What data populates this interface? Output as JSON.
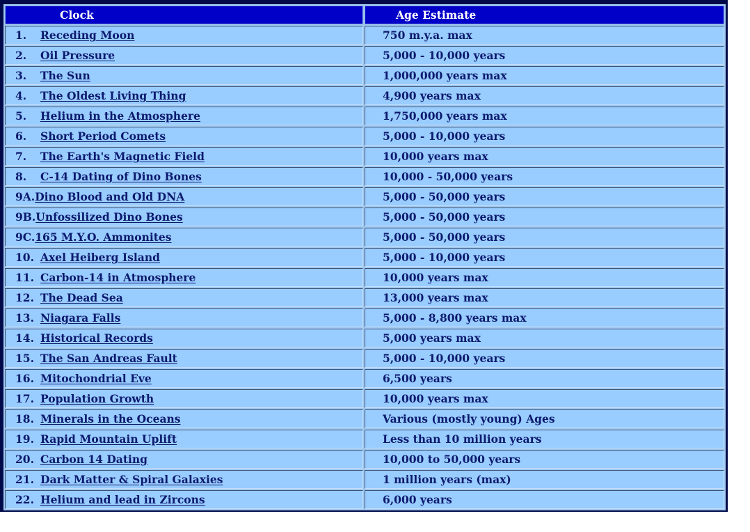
{
  "table": {
    "headers": {
      "clock": "Clock",
      "age": "Age Estimate"
    },
    "colors": {
      "header_bg": "#0000c8",
      "row_bg": "#99ccff",
      "text": "#0c1a6e",
      "frame": "#000a4a"
    },
    "rows": [
      {
        "num": "1.",
        "clock": "Receding Moon",
        "age": "750 m.y.a. max"
      },
      {
        "num": "2.",
        "clock": "Oil Pressure",
        "age": "5,000 - 10,000 years"
      },
      {
        "num": "3.",
        "clock": "The Sun",
        "age": "1,000,000 years max"
      },
      {
        "num": "4.",
        "clock": "The Oldest Living Thing",
        "age": "4,900 years max"
      },
      {
        "num": "5.",
        "clock": "Helium in the Atmosphere",
        "age": "1,750,000 years max"
      },
      {
        "num": "6.",
        "clock": "Short Period Comets",
        "age": "5,000 - 10,000 years"
      },
      {
        "num": "7.",
        "clock": "The Earth's Magnetic Field",
        "age": "10,000 years max"
      },
      {
        "num": "8.",
        "clock": "C-14 Dating of Dino Bones",
        "age": "10,000 - 50,000 years"
      },
      {
        "num": "9A.",
        "clock": "Dino Blood and Old DNA",
        "age": "5,000 - 50,000 years"
      },
      {
        "num": "9B.",
        "clock": "Unfossilized Dino Bones",
        "age": "5,000 - 50,000 years"
      },
      {
        "num": "9C.",
        "clock": "165 M.Y.O. Ammonites",
        "age": "5,000 - 50,000 years"
      },
      {
        "num": "10.",
        "clock": "Axel Heiberg Island",
        "age": "5,000 - 10,000 years"
      },
      {
        "num": "11.",
        "clock": "Carbon-14 in Atmosphere",
        "age": "10,000 years max"
      },
      {
        "num": "12.",
        "clock": "The Dead Sea",
        "age": "13,000 years max"
      },
      {
        "num": "13.",
        "clock": "Niagara Falls",
        "age": "5,000 - 8,800 years max"
      },
      {
        "num": "14.",
        "clock": "Historical Records",
        "age": "5,000 years max"
      },
      {
        "num": "15.",
        "clock": "The San Andreas Fault",
        "age": "5,000 - 10,000 years"
      },
      {
        "num": "16.",
        "clock": "Mitochondrial Eve",
        "age": "6,500 years"
      },
      {
        "num": "17.",
        "clock": "Population Growth",
        "age": "10,000 years max"
      },
      {
        "num": "18.",
        "clock": "Minerals in the Oceans",
        "age": "Various (mostly young) Ages"
      },
      {
        "num": "19.",
        "clock": "Rapid Mountain Uplift",
        "age": "Less than 10 million years"
      },
      {
        "num": "20.",
        "clock": "Carbon 14 Dating",
        "age": "10,000 to 50,000 years"
      },
      {
        "num": "21.",
        "clock": "Dark Matter & Spiral Galaxies",
        "age": "1 million years (max)"
      },
      {
        "num": "22.",
        "clock": "Helium and lead in Zircons",
        "age": "6,000 years"
      }
    ]
  }
}
